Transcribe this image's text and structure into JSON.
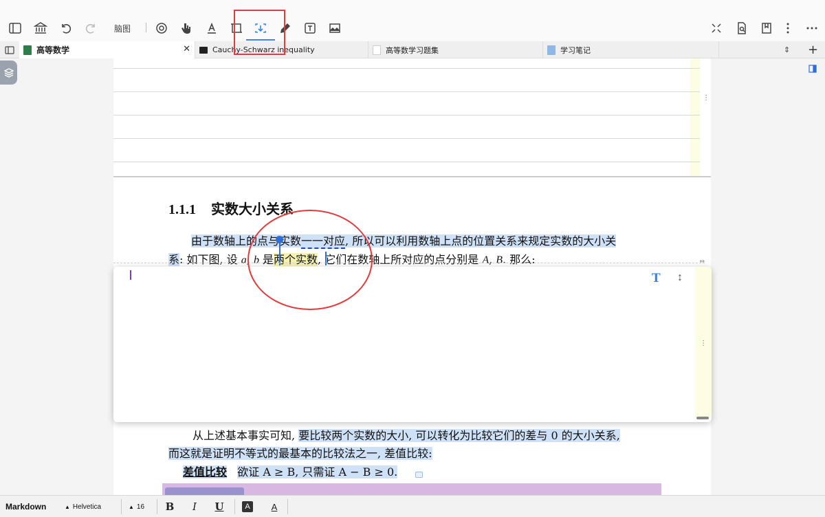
{
  "toolbar": {
    "mindmap_label": "脑图"
  },
  "tabs": [
    {
      "label": "高等数学",
      "icon": "book-green-icon",
      "active": true
    },
    {
      "label": "Cauchy-Schwarz inequality",
      "icon": "terminal-icon"
    },
    {
      "label": "高等数学习题集",
      "icon": "document-icon"
    },
    {
      "label": "学习笔记",
      "icon": "notebook-blue-icon"
    }
  ],
  "document": {
    "section_number": "1.1.1",
    "section_title": "实数大小关系",
    "para1_line1_a": "由于数轴上的点与实数",
    "para1_line1_b": "一一对应",
    "para1_line1_c": ", 所以可以利用数轴上点的位置关系来规定实数的大小关",
    "para1_line2_a": "系",
    "para1_line2_b": ": 如下图, 设 ",
    "var_a": "a",
    "comma": ", ",
    "var_b": "b",
    "para1_line2_c": " 是",
    "para1_line2_hl": "两个实数",
    "para1_line2_d": ", 它们在数轴上所对应的点分别是 ",
    "var_A": "A",
    "var_B": "B",
    "para1_line2_e": ". 那么:",
    "para2_line1_a": "从上述基本事实可知, ",
    "para2_line1_b": "要比较两个实数的大小, 可以转化为比较它们的差与 0 的大小关系,",
    "para2_line2": "而这就是证明不等式的最基本的比较法之一, 差值比较:",
    "para3_bold": "差值比较",
    "para3_rest": "欲证 A ≥ B, 只需证 A − B ≥ 0."
  },
  "note_editor": {
    "text_mode_icon": "T",
    "resize_icon": "↕"
  },
  "bottom_bar": {
    "mode": "Markdown",
    "font": "Helvetica",
    "size": "16",
    "bold": "B",
    "italic": "I",
    "underline": "U",
    "highlight": "A",
    "color": "A"
  },
  "colors": {
    "accent": "#3a86e8",
    "annotation_red": "#e23b3b",
    "highlight_blue": "#cfe1f6",
    "highlight_yellow": "#f6f3b2"
  }
}
